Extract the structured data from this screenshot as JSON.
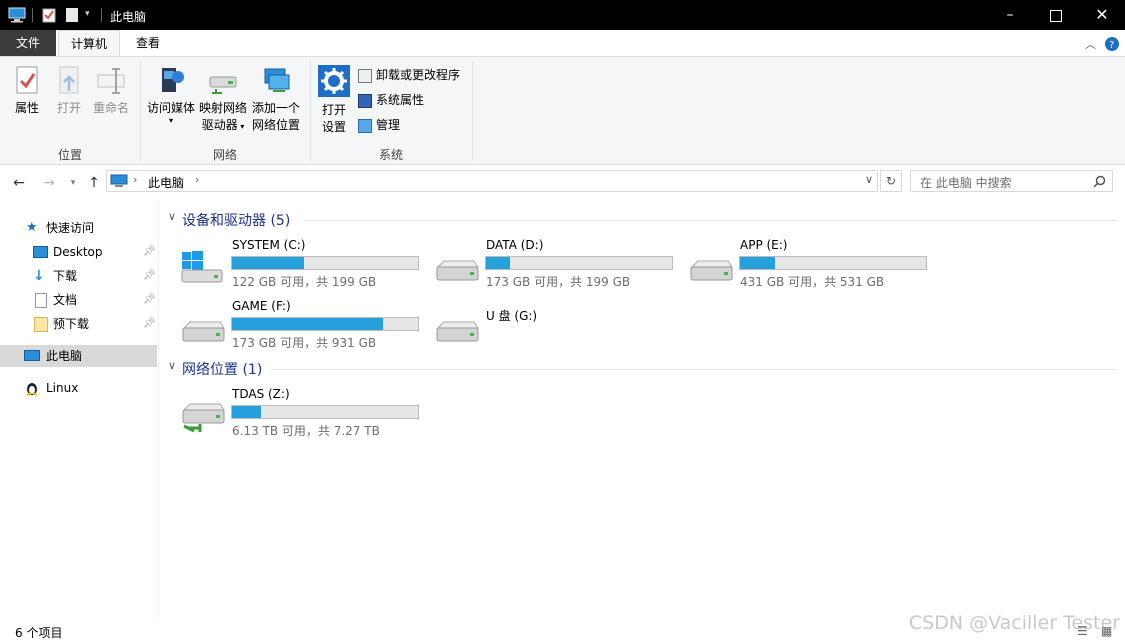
{
  "window": {
    "title": "此电脑"
  },
  "tabs": {
    "file": "文件",
    "computer": "计算机",
    "view": "查看"
  },
  "ribbon": {
    "location": {
      "label": "位置",
      "properties": "属性",
      "open": "打开",
      "rename": "重命名"
    },
    "network": {
      "label": "网络",
      "access_media": "访问媒体",
      "map_drive_l1": "映射网络",
      "map_drive_l2": "驱动器",
      "add_loc_l1": "添加一个",
      "add_loc_l2": "网络位置"
    },
    "system": {
      "label": "系统",
      "open_settings_l1": "打开",
      "open_settings_l2": "设置",
      "uninstall": "卸载或更改程序",
      "sys_props": "系统属性",
      "manage": "管理"
    }
  },
  "address": {
    "path": "此电脑",
    "search_placeholder": "在 此电脑 中搜索"
  },
  "nav": {
    "quick_access": "快速访问",
    "desktop": "Desktop",
    "downloads": "下载",
    "documents": "文档",
    "pre_download": "预下载",
    "this_pc": "此电脑",
    "linux": "Linux"
  },
  "devices": {
    "title": "设备和驱动器 (5)",
    "drives": [
      {
        "name": "SYSTEM (C:)",
        "free": "122 GB 可用，共 199 GB",
        "used_fraction": 0.387
      },
      {
        "name": "DATA (D:)",
        "free": "173 GB 可用，共 199 GB",
        "used_fraction": 0.13
      },
      {
        "name": "APP (E:)",
        "free": "431 GB 可用，共 531 GB",
        "used_fraction": 0.188
      },
      {
        "name": "GAME (F:)",
        "free": "173 GB 可用，共 931 GB",
        "used_fraction": 0.814
      },
      {
        "name": "U 盘 (G:)"
      }
    ]
  },
  "network_locations": {
    "title": "网络位置 (1)",
    "items": [
      {
        "name": "TDAS (Z:)",
        "free": "6.13 TB 可用，共 7.27 TB",
        "used_fraction": 0.157
      }
    ]
  },
  "status": {
    "items": "6 个项目"
  },
  "watermark": "CSDN @Vaciller Tester",
  "colors": {
    "accent": "#26a0da",
    "section_title": "#1e3287",
    "title_bar": "#000000"
  }
}
